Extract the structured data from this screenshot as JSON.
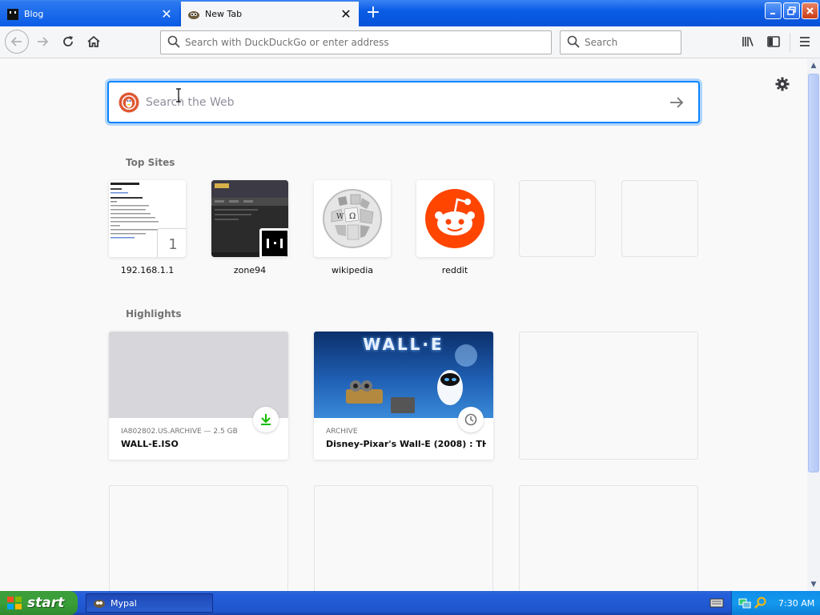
{
  "browser": {
    "tabs": [
      {
        "title": "Blog",
        "active": false
      },
      {
        "title": "New Tab",
        "active": true
      }
    ],
    "urlbar": {
      "placeholder": "Search with DuckDuckGo or enter address"
    },
    "searchbar": {
      "placeholder": "Search"
    }
  },
  "newtab": {
    "websearch": {
      "placeholder": "Search the Web"
    },
    "topsites_title": "Top Sites",
    "topsites": [
      {
        "label": "192.168.1.1",
        "badge": "1"
      },
      {
        "label": "zone94"
      },
      {
        "label": "wikipedia"
      },
      {
        "label": "reddit"
      },
      {
        "label": ""
      },
      {
        "label": ""
      }
    ],
    "highlights_title": "Highlights",
    "highlights": [
      {
        "context": "IA802802.US.ARCHIVE — 2.5 GB",
        "title": "WALL-E.ISO",
        "badge": "download-icon"
      },
      {
        "context": "ARCHIVE",
        "title": "Disney-Pixar's Wall-E (2008) : TH...",
        "badge": "history-icon",
        "image_text": "WALL·E"
      }
    ]
  },
  "taskbar": {
    "start_label": "start",
    "task_label": "Mypal",
    "clock": "7:30 AM"
  },
  "colors": {
    "accent": "#0a84ff",
    "reddit": "#ff4500",
    "xp_blue": "#245edb",
    "xp_green": "#3a9f38"
  }
}
